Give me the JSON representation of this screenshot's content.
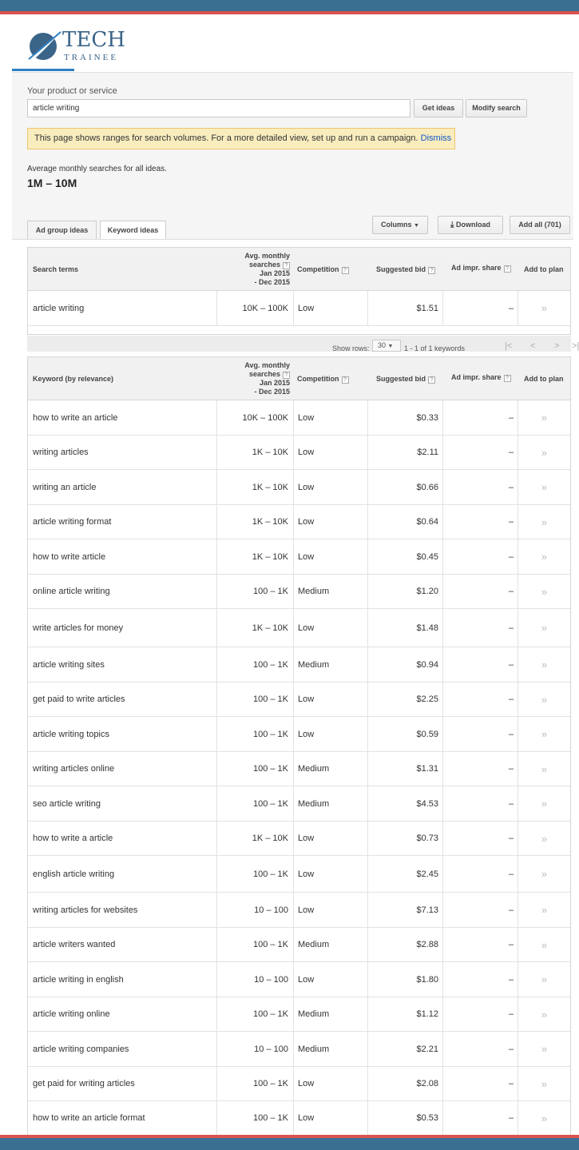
{
  "logo": {
    "brand": "TECH",
    "tagline": "TRAINEE"
  },
  "colors": {
    "top_bar": "#3a6f92",
    "accent_red": "#d9534f",
    "link": "#1155cc",
    "notice_bg": "#f9edbe"
  },
  "search": {
    "label": "Your product or service",
    "value": "article writing",
    "get_ideas": "Get ideas",
    "modify_search": "Modify search"
  },
  "notice": {
    "text": "This page shows ranges for search volumes. For a more detailed view, set up and run a campaign.",
    "dismiss": "Dismiss"
  },
  "summary": {
    "label": "Average monthly searches for all ideas.",
    "value": "1M – 10M"
  },
  "tabs": {
    "ad_group": "Ad group ideas",
    "keyword": "Keyword ideas"
  },
  "toolbar": {
    "columns": "Columns",
    "download": "Download",
    "add_all": "Add all (701)"
  },
  "search_table": {
    "headers": {
      "term": "Search terms",
      "avg_1": "Avg. monthly",
      "avg_2": "searches",
      "avg_3": "Jan 2015",
      "avg_4": "- Dec 2015",
      "competition": "Competition",
      "bid": "Suggested bid",
      "share": "Ad impr. share",
      "add": "Add to plan"
    },
    "rows": [
      {
        "term": "article writing",
        "volume": "10K – 100K",
        "competition": "Low",
        "bid": "$1.51",
        "share": "–",
        "add": "»"
      }
    ]
  },
  "pager": {
    "show_rows": "Show rows:",
    "rows": "30",
    "range": "1 - 1 of 1 keywords",
    "first": "|<",
    "prev": "<",
    "next": ">",
    "last": ">|"
  },
  "keyword_table": {
    "headers": {
      "term": "Keyword (by relevance)",
      "avg_1": "Avg. monthly",
      "avg_2": "searches",
      "avg_3": "Jan 2015",
      "avg_4": "- Dec 2015",
      "competition": "Competition",
      "bid": "Suggested bid",
      "share": "Ad impr. share",
      "add": "Add to plan"
    },
    "rows": [
      {
        "term": "how to write an article",
        "volume": "10K – 100K",
        "competition": "Low",
        "bid": "$0.33",
        "share": "–",
        "add": "»"
      },
      {
        "term": "writing articles",
        "volume": "1K – 10K",
        "competition": "Low",
        "bid": "$2.11",
        "share": "–",
        "add": "»"
      },
      {
        "term": "writing an article",
        "volume": "1K – 10K",
        "competition": "Low",
        "bid": "$0.66",
        "share": "–",
        "add": "»"
      },
      {
        "term": "article writing format",
        "volume": "1K – 10K",
        "competition": "Low",
        "bid": "$0.64",
        "share": "–",
        "add": "»"
      },
      {
        "term": "how to write article",
        "volume": "1K – 10K",
        "competition": "Low",
        "bid": "$0.45",
        "share": "–",
        "add": "»"
      },
      {
        "term": "online article writing",
        "volume": "100 – 1K",
        "competition": "Medium",
        "bid": "$1.20",
        "share": "–",
        "add": "»"
      },
      {
        "term": "write articles for money",
        "volume": "1K – 10K",
        "competition": "Low",
        "bid": "$1.48",
        "share": "–",
        "add": "»"
      },
      {
        "term": "article writing sites",
        "volume": "100 – 1K",
        "competition": "Medium",
        "bid": "$0.94",
        "share": "–",
        "add": "»"
      },
      {
        "term": "get paid to write articles",
        "volume": "100 – 1K",
        "competition": "Low",
        "bid": "$2.25",
        "share": "–",
        "add": "»"
      },
      {
        "term": "article writing topics",
        "volume": "100 – 1K",
        "competition": "Low",
        "bid": "$0.59",
        "share": "–",
        "add": "»"
      },
      {
        "term": "writing articles online",
        "volume": "100 – 1K",
        "competition": "Medium",
        "bid": "$1.31",
        "share": "–",
        "add": "»"
      },
      {
        "term": "seo article writing",
        "volume": "100 – 1K",
        "competition": "Medium",
        "bid": "$4.53",
        "share": "–",
        "add": "»"
      },
      {
        "term": "how to write a article",
        "volume": "1K – 10K",
        "competition": "Low",
        "bid": "$0.73",
        "share": "–",
        "add": "»"
      },
      {
        "term": "english article writing",
        "volume": "100 – 1K",
        "competition": "Low",
        "bid": "$2.45",
        "share": "–",
        "add": "»"
      },
      {
        "term": "writing articles for websites",
        "volume": "10 – 100",
        "competition": "Low",
        "bid": "$7.13",
        "share": "–",
        "add": "»"
      },
      {
        "term": "article writers wanted",
        "volume": "100 – 1K",
        "competition": "Medium",
        "bid": "$2.88",
        "share": "–",
        "add": "»"
      },
      {
        "term": "article writing in english",
        "volume": "10 – 100",
        "competition": "Low",
        "bid": "$1.80",
        "share": "–",
        "add": "»"
      },
      {
        "term": "article writing online",
        "volume": "100 – 1K",
        "competition": "Medium",
        "bid": "$1.12",
        "share": "–",
        "add": "»"
      },
      {
        "term": "article writing companies",
        "volume": "10 – 100",
        "competition": "Medium",
        "bid": "$2.21",
        "share": "–",
        "add": "»"
      },
      {
        "term": "get paid for writing articles",
        "volume": "100 – 1K",
        "competition": "Low",
        "bid": "$2.08",
        "share": "–",
        "add": "»"
      },
      {
        "term": "how to write an article format",
        "volume": "100 – 1K",
        "competition": "Low",
        "bid": "$0.53",
        "share": "–",
        "add": "»"
      }
    ]
  }
}
